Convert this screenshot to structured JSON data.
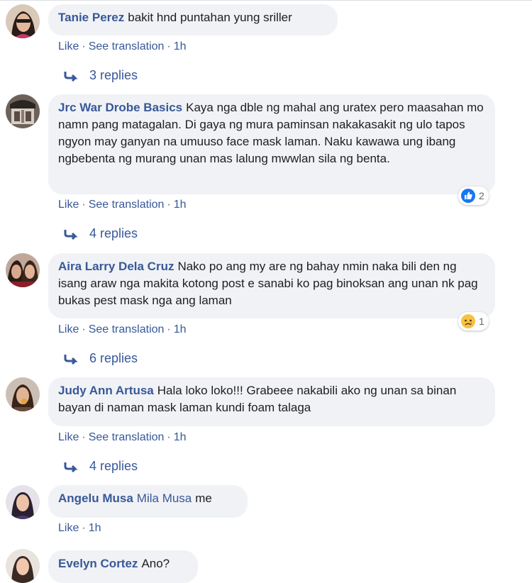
{
  "comments": [
    {
      "author": "Tanie Perez",
      "text": "bakit hnd puntahan yung sriller",
      "actions": {
        "like": "Like",
        "translate": "See translation",
        "time": "1h"
      },
      "replies": "3 replies"
    },
    {
      "author": "Jrc War Drobe Basics",
      "text": "Kaya nga dble ng mahal ang uratex pero maasahan mo namn pang matagalan. Di gaya ng mura paminsan nakakasakit ng ulo tapos ngyon may ganyan na umuuso face mask laman. Naku kawawa ung ibang ngbebenta ng murang unan mas lalung mwwlan sila ng benta.",
      "actions": {
        "like": "Like",
        "translate": "See translation",
        "time": "1h"
      },
      "reaction": {
        "icon": "like-reaction-icon",
        "count": "2"
      },
      "replies": "4 replies"
    },
    {
      "author": "Aira Larry Dela Cruz",
      "text": "Nako po ang my are ng bahay nmin naka bili den ng isang araw nga makita kotong post e sanabi ko pag binoksan ang unan nk pag bukas pest mask nga ang laman",
      "actions": {
        "like": "Like",
        "translate": "See translation",
        "time": "1h"
      },
      "reaction": {
        "icon": "sad-reaction-icon",
        "count": "1"
      },
      "replies": "6 replies"
    },
    {
      "author": "Judy Ann Artusa",
      "text": "Hala loko loko!!! Grabeee nakabili ako ng unan sa binan bayan di naman mask laman kundi foam talaga",
      "actions": {
        "like": "Like",
        "translate": "See translation",
        "time": "1h"
      },
      "replies": "4 replies"
    },
    {
      "author": "Angelu Musa",
      "mention": "Mila Musa",
      "text": "me",
      "actions": {
        "like": "Like",
        "time": "1h"
      }
    },
    {
      "author": "Evelyn Cortez",
      "text": "Ano?"
    }
  ],
  "colors": {
    "link": "#385898",
    "bubble": "#f0f2f5",
    "meta": "#606770"
  }
}
